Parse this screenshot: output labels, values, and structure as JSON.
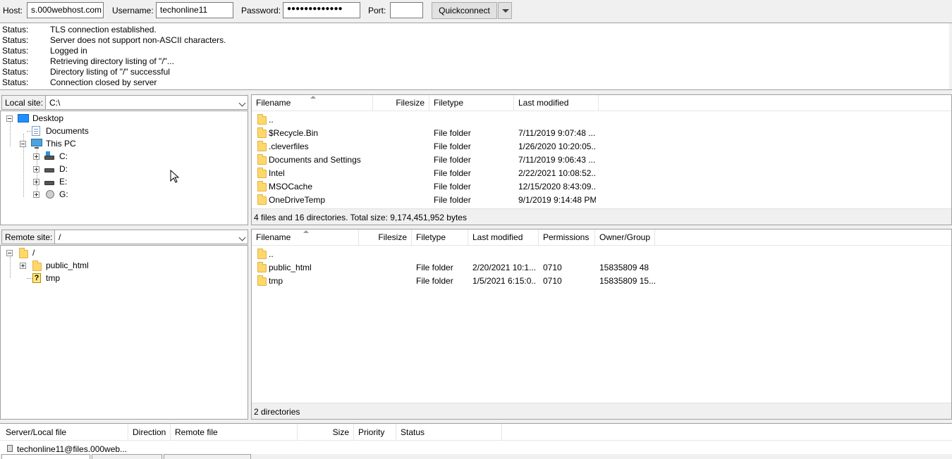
{
  "quickconnect": {
    "host_label": "Host:",
    "host_value": "s.000webhost.com",
    "username_label": "Username:",
    "username_value": "techonline11",
    "password_label": "Password:",
    "password_value": "●●●●●●●●●●●●●",
    "port_label": "Port:",
    "port_value": "",
    "quickconnect_label": "Quickconnect"
  },
  "log": [
    {
      "key": "Status:",
      "msg": "TLS connection established."
    },
    {
      "key": "Status:",
      "msg": "Server does not support non-ASCII characters."
    },
    {
      "key": "Status:",
      "msg": "Logged in"
    },
    {
      "key": "Status:",
      "msg": "Retrieving directory listing of \"/\"..."
    },
    {
      "key": "Status:",
      "msg": "Directory listing of \"/\" successful"
    },
    {
      "key": "Status:",
      "msg": "Connection closed by server"
    }
  ],
  "local": {
    "site_label": "Local site:",
    "site_path": "C:\\",
    "tree": {
      "desktop": "Desktop",
      "documents": "Documents",
      "this_pc": "This PC",
      "c": "C:",
      "d": "D:",
      "e": "E:",
      "g": "G:"
    },
    "columns": {
      "filename": "Filename",
      "filesize": "Filesize",
      "filetype": "Filetype",
      "last_modified": "Last modified"
    },
    "files": [
      {
        "name": "..",
        "size": "",
        "type": "",
        "modified": ""
      },
      {
        "name": "$Recycle.Bin",
        "size": "",
        "type": "File folder",
        "modified": "7/11/2019 9:07:48 ..."
      },
      {
        "name": ".cleverfiles",
        "size": "",
        "type": "File folder",
        "modified": "1/26/2020 10:20:05..."
      },
      {
        "name": "Documents and Settings",
        "size": "",
        "type": "File folder",
        "modified": "7/11/2019 9:06:43 ..."
      },
      {
        "name": "Intel",
        "size": "",
        "type": "File folder",
        "modified": "2/22/2021 10:08:52..."
      },
      {
        "name": "MSOCache",
        "size": "",
        "type": "File folder",
        "modified": "12/15/2020 8:43:09..."
      },
      {
        "name": "OneDriveTemp",
        "size": "",
        "type": "File folder",
        "modified": "9/1/2019 9:14:48 PM"
      }
    ],
    "status": "4 files and 16 directories. Total size: 9,174,451,952 bytes"
  },
  "remote": {
    "site_label": "Remote site:",
    "site_path": "/",
    "tree": {
      "root": "/",
      "public_html": "public_html",
      "tmp": "tmp"
    },
    "columns": {
      "filename": "Filename",
      "filesize": "Filesize",
      "filetype": "Filetype",
      "last_modified": "Last modified",
      "permissions": "Permissions",
      "owner_group": "Owner/Group"
    },
    "files": [
      {
        "name": "..",
        "size": "",
        "type": "",
        "modified": "",
        "perms": "",
        "owner": ""
      },
      {
        "name": "public_html",
        "size": "",
        "type": "File folder",
        "modified": "2/20/2021 10:1...",
        "perms": "0710",
        "owner": "15835809 48"
      },
      {
        "name": "tmp",
        "size": "",
        "type": "File folder",
        "modified": "1/5/2021 6:15:0...",
        "perms": "0710",
        "owner": "15835809 15..."
      }
    ],
    "status": "2 directories"
  },
  "queue": {
    "columns": {
      "server_local": "Server/Local file",
      "direction": "Direction",
      "remote_file": "Remote file",
      "size": "Size",
      "priority": "Priority",
      "status": "Status"
    },
    "rows": [
      {
        "server": "techonline11@files.000web..."
      }
    ]
  }
}
